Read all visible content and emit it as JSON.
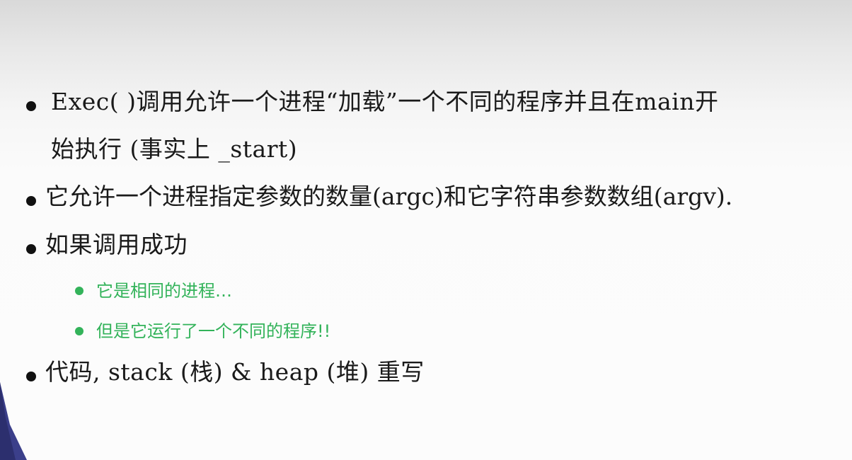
{
  "slide": {
    "bullets": [
      {
        "line1": "Exec( )调用允许一个进程“加载”一个不同的程序并且在main开",
        "line2": "始执行 (事实上 _start)"
      },
      {
        "line1": "它允许一个进程指定参数的数量(argc)和它字符串参数数组(argv)."
      },
      {
        "line1": "如果调用成功",
        "sub_items": [
          "它是相同的进程…",
          "但是它运行了一个不同的程序!!"
        ]
      },
      {
        "line1": "代码, stack (栈) & heap (堆) 重写"
      }
    ],
    "colors": {
      "text": "#1a1a1a",
      "sub_text": "#33b35a",
      "corner_shape": "#3b3f8a"
    }
  }
}
